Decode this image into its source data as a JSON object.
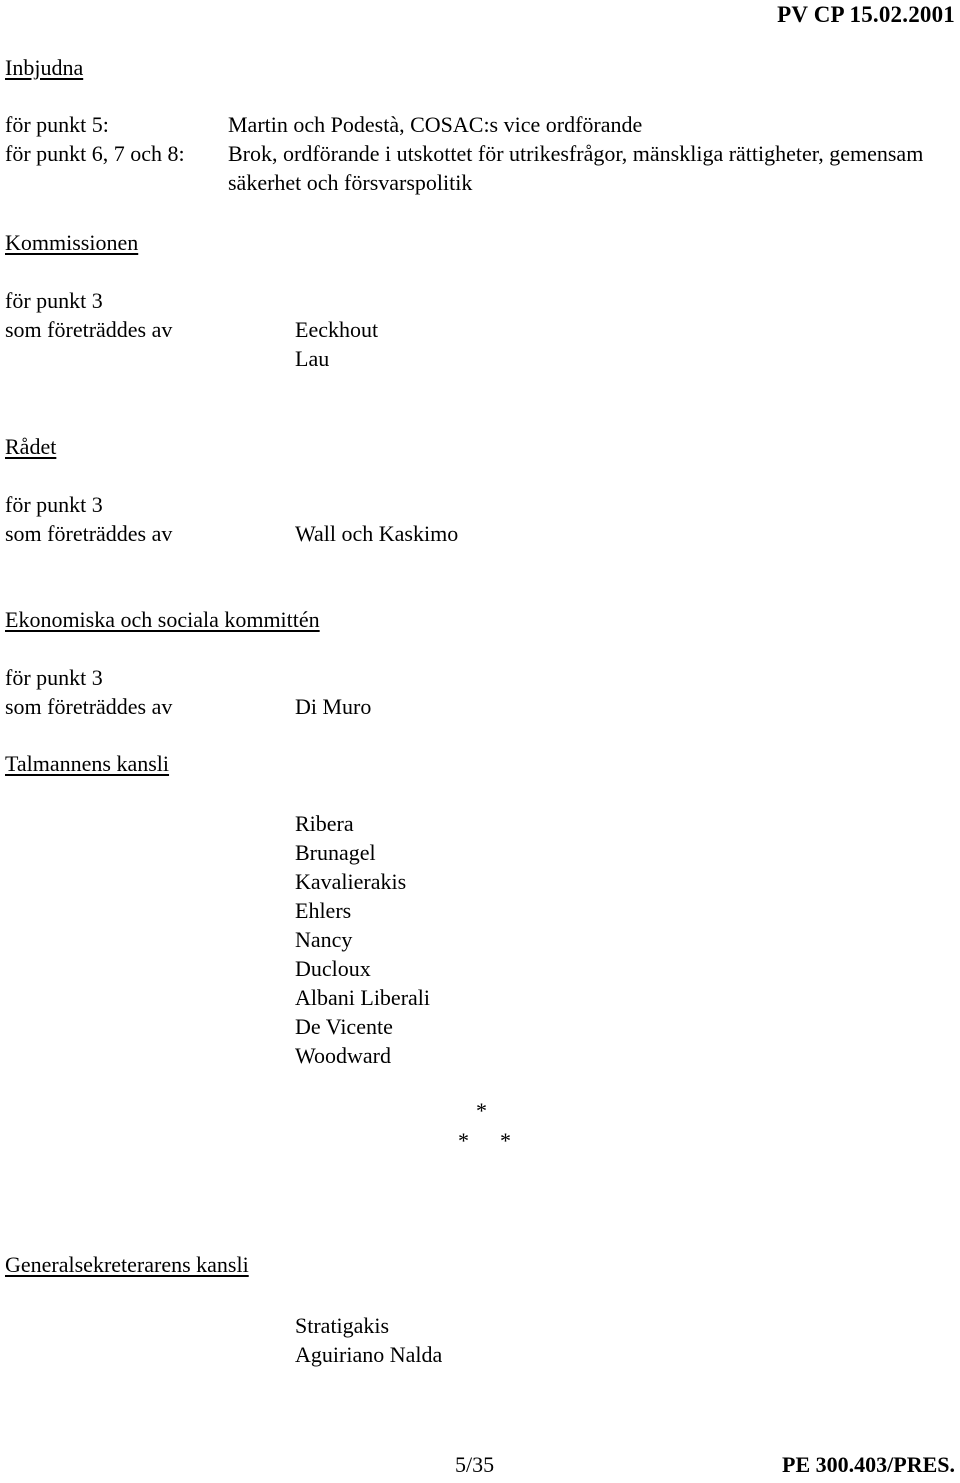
{
  "header": {
    "reference": "PV CP 15.02.2001"
  },
  "sections": {
    "invited": {
      "heading": "Inbjudna",
      "rows": [
        {
          "label": "för punkt 5:",
          "value": "Martin och Podestà, COSAC:s vice ordförande"
        },
        {
          "label": "för punkt 6, 7 och 8:",
          "value": "Brok, ordförande i utskottet för utrikesfrågor, mänskliga rättigheter, gemensam säkerhet och försvarspolitik"
        }
      ]
    },
    "commission": {
      "heading": "Kommissionen",
      "item_label": "för punkt 3",
      "represented_label": "som företräddes av",
      "names": [
        "Eeckhout",
        "Lau"
      ]
    },
    "council": {
      "heading": "Rådet",
      "item_label": "för punkt 3",
      "represented_label": "som företräddes av",
      "names": [
        "Wall och Kaskimo"
      ]
    },
    "economic_social_committee": {
      "heading": "Ekonomiska och sociala kommittén",
      "item_label": "för punkt 3",
      "represented_label": "som företräddes av",
      "names": [
        "Di Muro"
      ]
    },
    "presidents_office": {
      "heading": "Talmannens kansli",
      "names": [
        "Ribera",
        "Brunagel",
        "Kavalierakis",
        "Ehlers",
        "Nancy",
        "Ducloux",
        "Albani Liberali",
        "De Vicente",
        "Woodward"
      ]
    },
    "secretary_general_office": {
      "heading": "Generalsekreterarens kansli",
      "names": [
        "Stratigakis",
        "Aguiriano Nalda"
      ]
    }
  },
  "separator": {
    "top": "*",
    "left": "*",
    "right": "*"
  },
  "footer": {
    "page_number": "5/35",
    "document_reference": "PE 300.403/PRES."
  }
}
